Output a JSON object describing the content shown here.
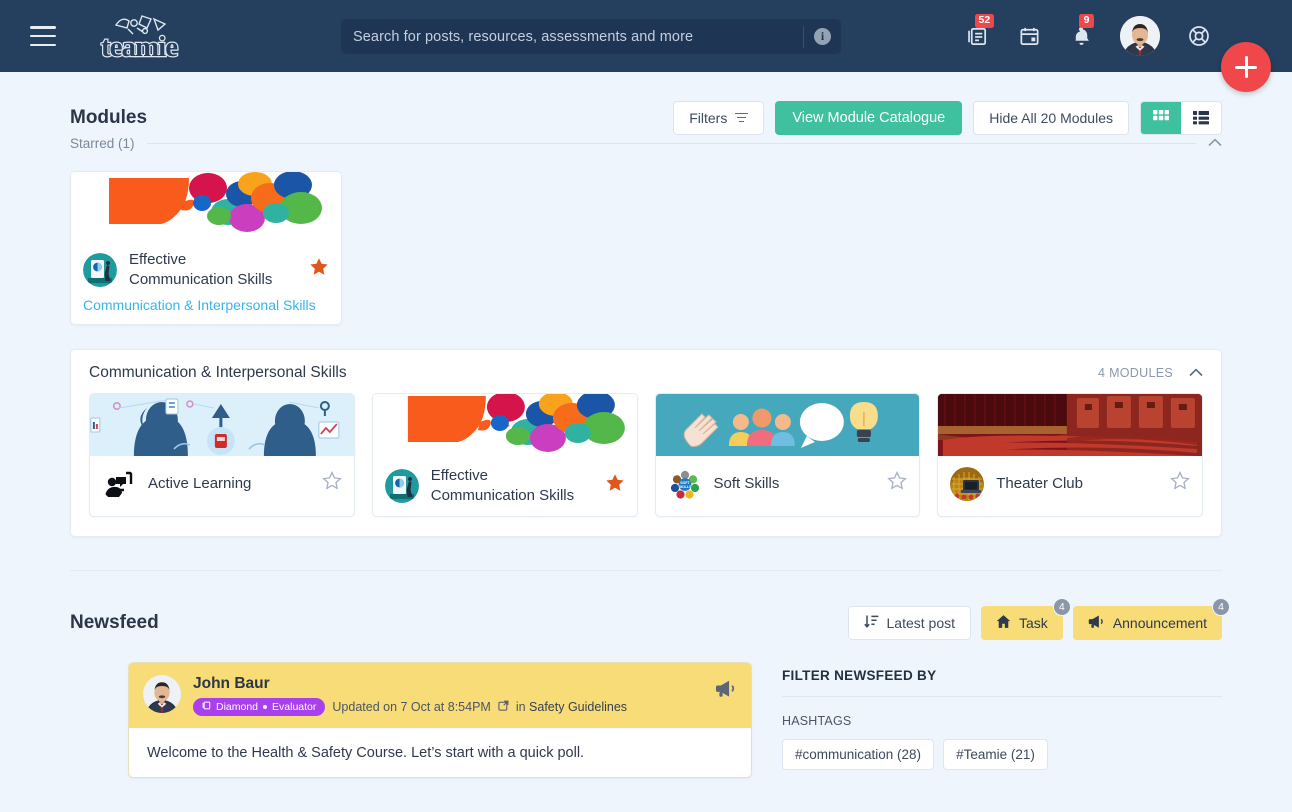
{
  "topnav": {
    "menu_icon": "hamburger-menu-icon",
    "logo_text": "teamie",
    "search": {
      "placeholder": "Search for posts, resources, assessments and more",
      "value": "",
      "info_icon": "info-icon"
    },
    "icons": [
      {
        "name": "library-icon",
        "badge": "52"
      },
      {
        "name": "calendar-icon",
        "badge": ""
      },
      {
        "name": "bell-icon",
        "badge": "9"
      }
    ],
    "avatar_name": "user-avatar",
    "help_icon": "lifebuoy-help-icon",
    "fab_label": "+",
    "accent_red": "#f0484a",
    "nav_bg": "#253f5e"
  },
  "modules": {
    "title": "Modules",
    "filters_label": "Filters",
    "catalogue_label": "View Module Catalogue",
    "hide_label": "Hide All 20 Modules",
    "view_grid_icon": "grid-view-icon",
    "view_list_icon": "list-view-icon",
    "accent_green": "#3fc1a0",
    "starred": {
      "label": "Starred (1)",
      "collapse_icon": "chevron-up-icon",
      "card": {
        "name": "Effective\nCommunication Skills",
        "name_line1": "Effective",
        "name_line2": "Communication Skills",
        "group": "Communication & Interpersonal Skills",
        "starred": true,
        "star_icon": "star-filled-icon"
      }
    },
    "group": {
      "title": "Communication & Interpersonal Skills",
      "count_label": "4 MODULES",
      "collapse_icon": "chevron-up-icon",
      "cards": [
        {
          "name": "Active Learning",
          "line1": "Active Learning",
          "line2": "",
          "starred": false,
          "star_icon": "star-outline-icon"
        },
        {
          "name": "Effective Communication Skills",
          "line1": "Effective",
          "line2": "Communication Skills",
          "starred": true,
          "star_icon": "star-filled-icon"
        },
        {
          "name": "Soft Skills",
          "line1": "Soft Skills",
          "line2": "",
          "starred": false,
          "star_icon": "star-outline-icon"
        },
        {
          "name": "Theater Club",
          "line1": "Theater Club",
          "line2": "",
          "starred": false,
          "star_icon": "star-outline-icon"
        }
      ]
    }
  },
  "newsfeed": {
    "title": "Newsfeed",
    "sort_label": "Latest post",
    "sort_icon": "sort-icon",
    "task_label": "Task",
    "task_icon": "home-icon",
    "task_badge": "4",
    "announcement_label": "Announcement",
    "announcement_icon": "megaphone-icon",
    "announcement_badge": "4",
    "accent_yellow": "#f7dc77",
    "post": {
      "author": "John Baur",
      "badge_text": "Diamond",
      "badge_role": "Evaluator",
      "badge_icon": "diamond-book-icon",
      "badge_color": "#a840ef",
      "updated": "Updated on 7 Oct at 8:54PM",
      "external_icon": "external-link-icon",
      "in_label": "in",
      "in_target": "Safety Guidelines",
      "pin_icon": "megaphone-icon",
      "body": "Welcome to the Health & Safety Course. Let’s start with a quick poll."
    },
    "filter": {
      "title": "FILTER NEWSFEED BY",
      "hashtags_label": "HASHTAGS",
      "hashtags": [
        "#communication (28)",
        "#Teamie (21)"
      ]
    }
  }
}
